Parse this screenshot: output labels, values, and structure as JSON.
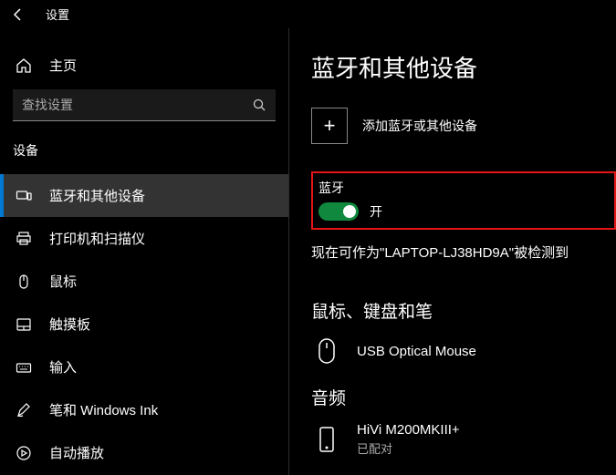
{
  "titlebar": {
    "title": "设置"
  },
  "sidebar": {
    "home": "主页",
    "search_placeholder": "查找设置",
    "section": "设备",
    "items": [
      {
        "label": "蓝牙和其他设备"
      },
      {
        "label": "打印机和扫描仪"
      },
      {
        "label": "鼠标"
      },
      {
        "label": "触摸板"
      },
      {
        "label": "输入"
      },
      {
        "label": "笔和 Windows Ink"
      },
      {
        "label": "自动播放"
      }
    ]
  },
  "content": {
    "title": "蓝牙和其他设备",
    "add_label": "添加蓝牙或其他设备",
    "bt_section": "蓝牙",
    "toggle_state": "开",
    "discoverable": "现在可作为\"LAPTOP-LJ38HD9A\"被检测到",
    "mouse_section": "鼠标、键盘和笔",
    "mouse_device": "USB Optical Mouse",
    "audio_section": "音频",
    "audio_device": {
      "name": "HiVi M200MKIII+",
      "status": "已配对"
    }
  }
}
